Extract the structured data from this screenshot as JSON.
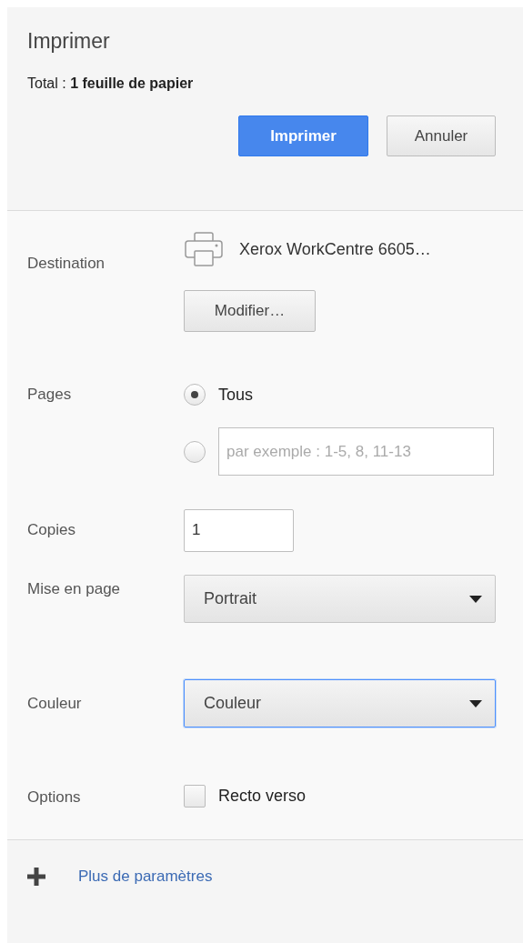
{
  "title": "Imprimer",
  "total": "Total : **1 feuille de papier**",
  "buttons": [
    {
      "label": "Imprimer",
      "kind": "primary"
    },
    {
      "label": "Annuler",
      "kind": "secondary"
    }
  ],
  "settings": [
    {
      "label": "Destination",
      "kind": "destination",
      "printer": "Xerox WorkCentre 6605…",
      "button": "Modifier…"
    },
    {
      "label": "Pages",
      "kind": "radios",
      "options": [
        {
          "kind": "text",
          "label": "Tous",
          "selected": true
        },
        {
          "kind": "field",
          "placeholder": "par exemple : 1-5, 8, 11-13",
          "selected": false
        }
      ]
    },
    {
      "label": "Copies",
      "kind": "number",
      "value": "1"
    },
    {
      "label": "Mise en page",
      "kind": "select",
      "value": "Portrait",
      "focused": false
    },
    {
      "label": "Couleur",
      "kind": "select",
      "value": "Couleur",
      "focused": true
    },
    {
      "label": "Options",
      "kind": "checkboxes",
      "options": [
        {
          "label": "Recto verso",
          "checked": false
        }
      ]
    }
  ],
  "more": {
    "label": "Plus de paramètres",
    "expanded": false
  }
}
